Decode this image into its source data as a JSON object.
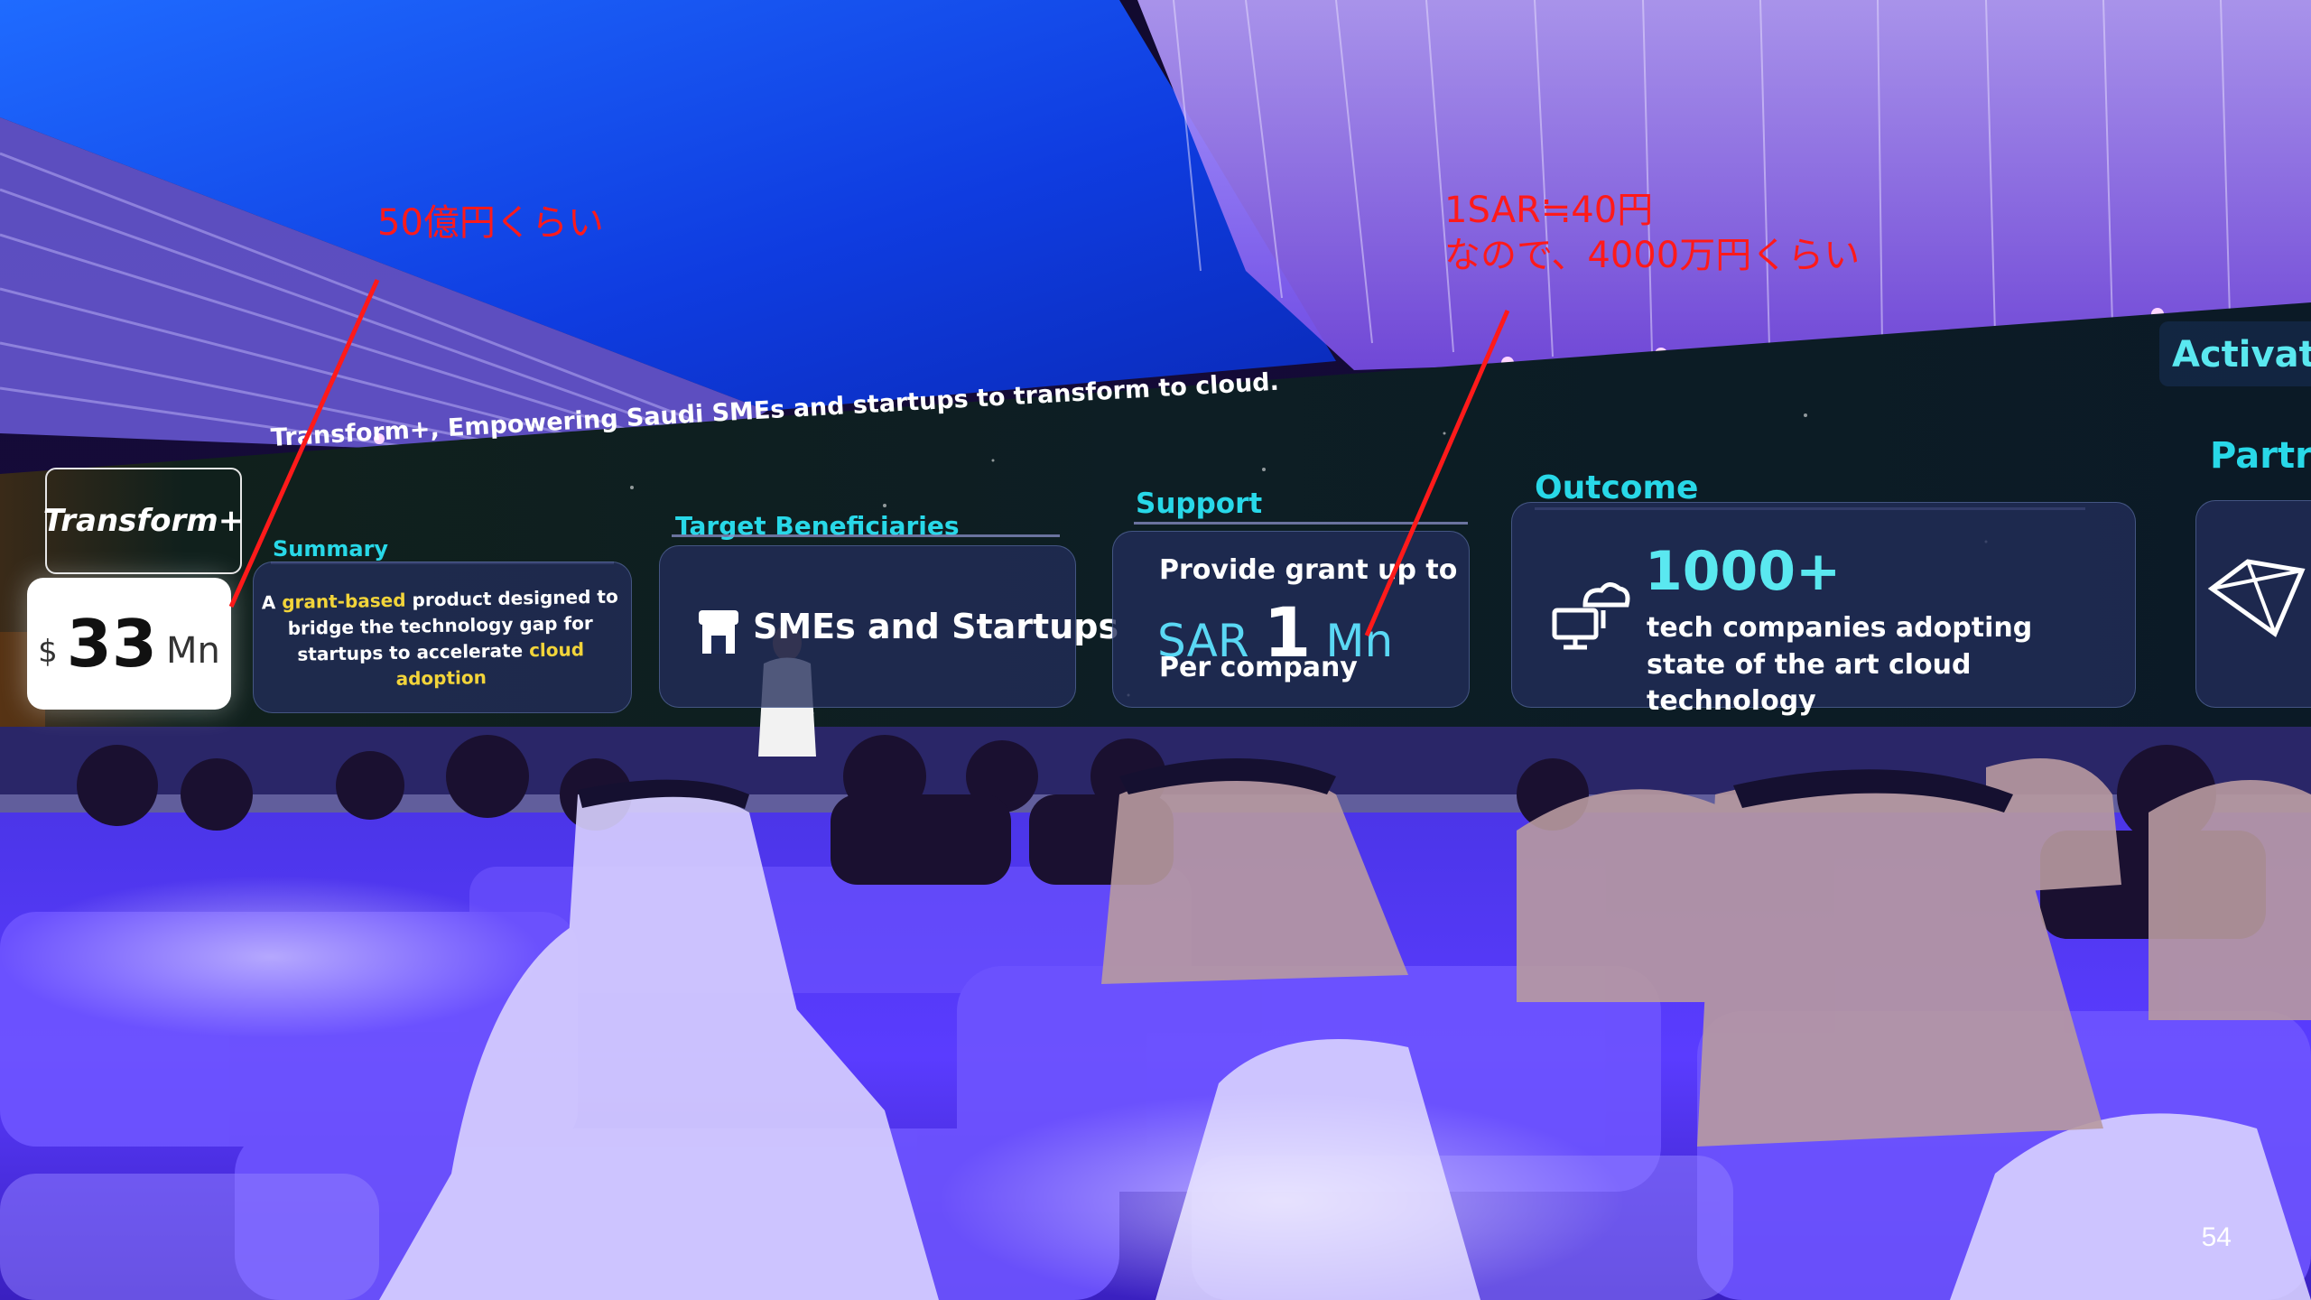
{
  "stage": {
    "title": "Transform+, Empowering Saudi SMEs and startups to transform to cloud.",
    "logo": "Transform+",
    "budget": {
      "currency": "$",
      "number": "33",
      "unit": "Mn"
    },
    "summary": {
      "heading": "Summary",
      "part1": "A ",
      "highlight1": "grant-based",
      "part2": " product designed to bridge the technology gap for startups to accelerate ",
      "highlight2": "cloud adoption"
    },
    "target": {
      "heading": "Target Beneficiaries",
      "text": "SMEs and Startups",
      "icon": "store-icon"
    },
    "support": {
      "heading": "Support",
      "line1": "Provide grant up to",
      "currency": "SAR",
      "amount": "1",
      "unit": "Mn",
      "line3": "Per company"
    },
    "outcome": {
      "heading": "Outcome",
      "number": "1000+",
      "description": "tech companies adopting state of the art cloud technology",
      "icon": "cloud-computer-icon"
    },
    "activate": "Activat",
    "partners_heading": "Partr",
    "partner_icon": "crystal-icon"
  },
  "annotations": {
    "left_note": "50億円くらい",
    "right_note_line1": "1SAR≒40円",
    "right_note_line2": "なので、4000万円くらい",
    "color": "#ff1a1a"
  },
  "page_number": "54",
  "colors": {
    "heading_cyan": "#28d8e8",
    "highlight_yellow": "#f2d43a",
    "ceiling_blue": "#1a5cff",
    "seat_purple": "#5a3cff"
  }
}
